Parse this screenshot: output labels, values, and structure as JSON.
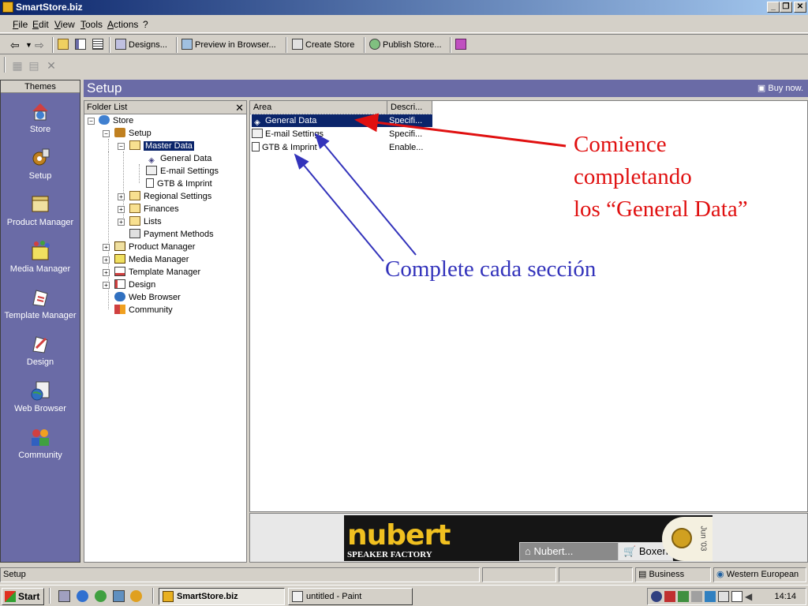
{
  "window": {
    "title": "SmartStore.biz"
  },
  "menu": {
    "items": [
      "File",
      "Edit",
      "View",
      "Tools",
      "Actions",
      "?"
    ]
  },
  "toolbar": {
    "designs": "Designs...",
    "preview": "Preview in Browser...",
    "create_store": "Create Store",
    "publish_store": "Publish Store..."
  },
  "themes": {
    "header": "Themes",
    "items": [
      "Store",
      "Setup",
      "Product Manager",
      "Media Manager",
      "Template Manager",
      "Design",
      "Web Browser",
      "Community"
    ]
  },
  "setup": {
    "title": "Setup",
    "buy_now": "Buy now."
  },
  "folder_list": {
    "header": "Folder List",
    "close": "✕",
    "nodes": [
      "Store",
      "Setup",
      "Master Data",
      "General Data",
      "E-mail Settings",
      "GTB & Imprint",
      "Regional Settings",
      "Finances",
      "Lists",
      "Payment Methods",
      "Product Manager",
      "Media Manager",
      "Template Manager",
      "Design",
      "Web Browser",
      "Community"
    ]
  },
  "area_list": {
    "col_area": "Area",
    "col_desc": "Descri...",
    "rows": [
      {
        "area": "General Data",
        "desc": "Specifi..."
      },
      {
        "area": "E-mail Settings",
        "desc": "Specifi..."
      },
      {
        "area": "GTB & Imprint",
        "desc": "Enable..."
      }
    ]
  },
  "annotations": {
    "red_line1": "Comience",
    "red_line2": "completando",
    "red_line3": "los “General Data”",
    "blue": "Complete cada sección",
    "red_color": "#e01010",
    "blue_color": "#3333bb"
  },
  "banner": {
    "logo": "nubert",
    "tagline": "SPEAKER FACTORY",
    "tab1": "Nubert...",
    "tab2": "Boxen",
    "badge": "Jun '03"
  },
  "statusbar": {
    "left": "Setup",
    "business": "Business",
    "region": "Western European"
  },
  "taskbar": {
    "start": "Start",
    "task1": "SmartStore.biz",
    "task2": "untitled - Paint",
    "clock": "14:14"
  }
}
